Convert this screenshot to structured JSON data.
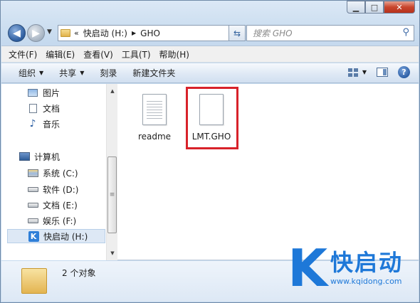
{
  "nav": {
    "back_icon": "back-arrow-icon",
    "forward_icon": "forward-arrow-icon",
    "address": {
      "overflow": "«",
      "crumbs": [
        "快启动 (H:)",
        "GHO"
      ]
    },
    "search_placeholder": "搜索 GHO"
  },
  "menu": [
    "文件(F)",
    "编辑(E)",
    "查看(V)",
    "工具(T)",
    "帮助(H)"
  ],
  "toolbar": {
    "organize": "组织",
    "share": "共享",
    "burn": "刻录",
    "new_folder": "新建文件夹"
  },
  "sidebar": {
    "libraries": [
      {
        "label": "图片",
        "icon": "pictures-icon"
      },
      {
        "label": "文档",
        "icon": "documents-icon"
      },
      {
        "label": "音乐",
        "icon": "music-icon"
      }
    ],
    "computer": {
      "label": "计算机",
      "icon": "computer-icon"
    },
    "drives": [
      {
        "label": "系统 (C:)",
        "icon": "system-drive-icon"
      },
      {
        "label": "软件 (D:)",
        "icon": "drive-icon"
      },
      {
        "label": "文档 (E:)",
        "icon": "drive-icon"
      },
      {
        "label": "娱乐 (F:)",
        "icon": "drive-icon"
      },
      {
        "label": "快启动 (H:)",
        "icon": "kqidong-drive-icon",
        "selected": true
      }
    ]
  },
  "files": [
    {
      "name": "readme",
      "icon": "text-file-icon"
    },
    {
      "name": "LMT.GHO",
      "icon": "blank-file-icon",
      "highlighted": true
    }
  ],
  "details": {
    "count": "2 个对象"
  },
  "watermark": {
    "letter": "K",
    "name": "快启动",
    "url": "www.kqidong.com"
  },
  "colors": {
    "highlight": "#d8222a",
    "brand": "#1e78d8"
  }
}
